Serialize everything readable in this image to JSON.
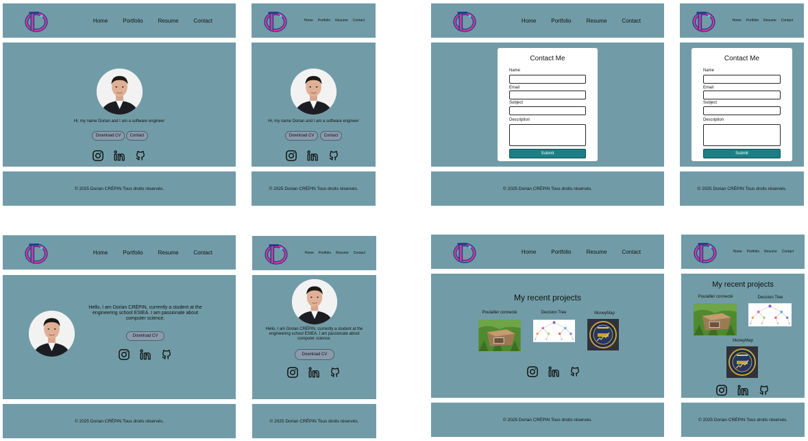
{
  "nav": {
    "home": "Home",
    "portfolio": "Portfolio",
    "resume": "Resume",
    "contact": "Contact"
  },
  "hero": {
    "short_intro": "Hi, my name Dorian and I am a software engineer",
    "long_intro": "Hello, I am Dorian CRÉPIN, currently a student at the engineering school ESIEA. I am passionate about computer science.",
    "download_cv": "Download CV",
    "contact_button": "Contact"
  },
  "contact_form": {
    "title": "Contact Me",
    "name_label": "Name",
    "email_label": "Email",
    "subject_label": "Subject",
    "description_label": "Description",
    "submit_label": "Submit"
  },
  "projects": {
    "title": "My recent projects",
    "items": [
      {
        "label": "Poulailler connecté"
      },
      {
        "label": "Decision Tree"
      },
      {
        "label": "MoneyMap"
      }
    ]
  },
  "footer": {
    "copyright": "© 2025 Dorian CRÉPIN Tous droits réservés."
  },
  "colors": {
    "panel": "#719ca7",
    "submit": "#1b7f85",
    "pill": "#8a9aad"
  },
  "icons": [
    "logo-icon",
    "instagram-icon",
    "linkedin-icon",
    "github-icon"
  ]
}
